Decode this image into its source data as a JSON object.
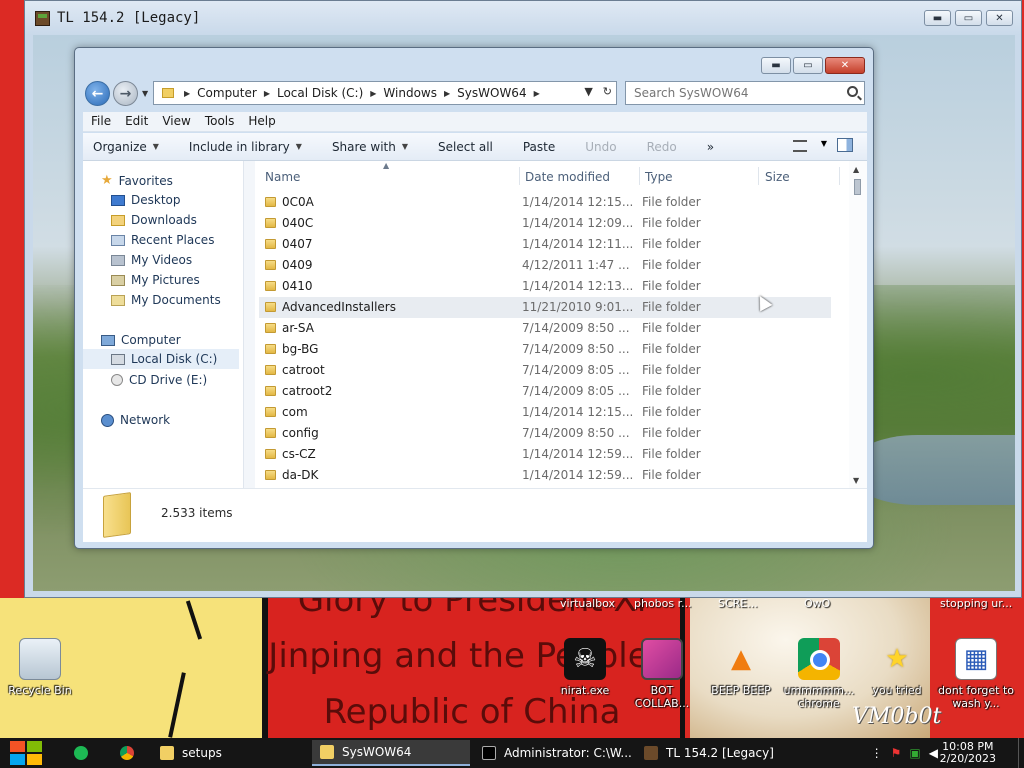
{
  "colors": {
    "wallpaper_red": "#dc2a24",
    "taskbar": "#151515",
    "explorer_frame": "#cfdff0",
    "folder_yellow": "#e3b845"
  },
  "tl_window": {
    "title": "TL 154.2 [Legacy]",
    "buttons": [
      "minimize-icon",
      "maximize-icon",
      "close-icon"
    ]
  },
  "explorer": {
    "nav": {
      "back_icon": "back-arrow-icon",
      "forward_icon": "forward-arrow-icon"
    },
    "breadcrumbs": [
      "Computer",
      "Local Disk (C:)",
      "Windows",
      "SysWOW64"
    ],
    "search_placeholder": "Search SysWOW64",
    "menu": [
      "File",
      "Edit",
      "View",
      "Tools",
      "Help"
    ],
    "toolbar": {
      "organize": "Organize",
      "include": "Include in library",
      "share": "Share with",
      "select_all": "Select all",
      "paste": "Paste",
      "undo": "Undo",
      "redo": "Redo",
      "more": "»"
    },
    "sidebar": {
      "favorites": "Favorites",
      "fav_items": [
        "Desktop",
        "Downloads",
        "Recent Places",
        "My Videos",
        "My Pictures",
        "My Documents"
      ],
      "computer": "Computer",
      "computer_items": [
        "Local Disk (C:)",
        "CD Drive (E:)"
      ],
      "network": "Network"
    },
    "columns": {
      "name": "Name",
      "date": "Date modified",
      "type": "Type",
      "size": "Size"
    },
    "rows": [
      {
        "name": "0C0A",
        "date": "1/14/2014 12:15...",
        "type": "File folder"
      },
      {
        "name": "040C",
        "date": "1/14/2014 12:09...",
        "type": "File folder"
      },
      {
        "name": "0407",
        "date": "1/14/2014 12:11...",
        "type": "File folder"
      },
      {
        "name": "0409",
        "date": "4/12/2011 1:47 ...",
        "type": "File folder"
      },
      {
        "name": "0410",
        "date": "1/14/2014 12:13...",
        "type": "File folder"
      },
      {
        "name": "AdvancedInstallers",
        "date": "11/21/2010 9:01...",
        "type": "File folder"
      },
      {
        "name": "ar-SA",
        "date": "7/14/2009 8:50 ...",
        "type": "File folder"
      },
      {
        "name": "bg-BG",
        "date": "7/14/2009 8:50 ...",
        "type": "File folder"
      },
      {
        "name": "catroot",
        "date": "7/14/2009 8:05 ...",
        "type": "File folder"
      },
      {
        "name": "catroot2",
        "date": "7/14/2009 8:05 ...",
        "type": "File folder"
      },
      {
        "name": "com",
        "date": "1/14/2014 12:15...",
        "type": "File folder"
      },
      {
        "name": "config",
        "date": "7/14/2009 8:50 ...",
        "type": "File folder"
      },
      {
        "name": "cs-CZ",
        "date": "1/14/2014 12:59...",
        "type": "File folder"
      },
      {
        "name": "da-DK",
        "date": "1/14/2014 12:59...",
        "type": "File folder"
      }
    ],
    "item_count": "2.533 items"
  },
  "wallpaper": {
    "poster_lines": [
      "Glory to President Xi",
      "Jinping and the People's",
      "Republic of China"
    ],
    "top_labels": [
      "virtualbox",
      "phobos r...",
      "SCRE...",
      "OwO",
      "stopping ur..."
    ],
    "watermark": "VM0b0t"
  },
  "desktop_icons": [
    {
      "label": "Recycle Bin",
      "icon": "recycle-bin-icon"
    },
    {
      "label": "nirat.exe",
      "icon": "skull-icon"
    },
    {
      "label": "BOT COLLAB...",
      "icon": "monitor-icon"
    },
    {
      "label": "BEEP BEEP",
      "icon": "vlc-cone-icon"
    },
    {
      "label": "ummmmm... chrome",
      "icon": "chrome-icon"
    },
    {
      "label": "you tried",
      "icon": "star-icon"
    },
    {
      "label": "dont forget to wash y...",
      "icon": "calendar-icon"
    }
  ],
  "taskbar": {
    "start_icon": "windows-logo-icon",
    "pinned": [
      "spotify-icon",
      "chrome-icon"
    ],
    "apps": [
      {
        "label": "setups",
        "icon": "folder-icon"
      },
      {
        "label": "SysWOW64",
        "icon": "folder-icon"
      },
      {
        "label": "Administrator: C:\\W...",
        "icon": "cmd-icon"
      },
      {
        "label": "TL 154.2 [Legacy]",
        "icon": "minecraft-block-icon"
      }
    ],
    "time": "10:08 PM",
    "date": "2/20/2023"
  }
}
